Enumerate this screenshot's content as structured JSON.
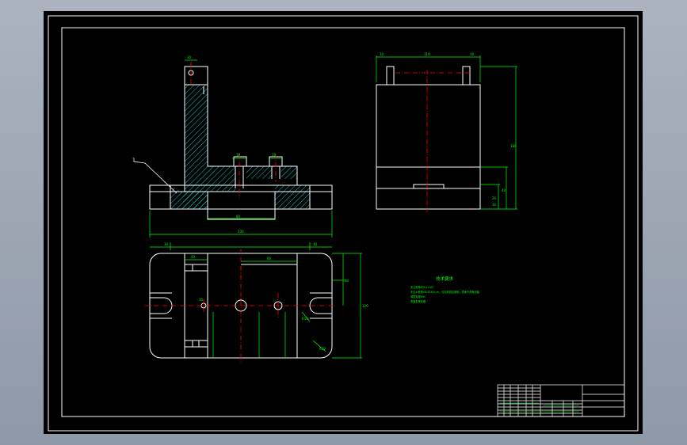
{
  "colors": {
    "background": "#000000",
    "outline": "#ffffff",
    "dimension": "#00ff00",
    "centerline": "#ff0000",
    "hatch": "#00ffff"
  },
  "part_label": "1",
  "tech_requirements": {
    "title": "技术要求",
    "lines": [
      "未注倒角均为1×45°",
      "未注公差按GB/T1804-m，去毛刺锐边倒钝，表面不得有划痕",
      "调质处理HRC",
      "表面发黑处理"
    ]
  },
  "dimensions": {
    "front_top": "30",
    "front_hole": "10",
    "front_right_hole": "10",
    "front_slot": "80",
    "front_total": "230",
    "front_left": "30",
    "front_right": "30",
    "side_left": "10",
    "side_width": "110",
    "side_right": "10",
    "side_height": "180",
    "side_h1": "40",
    "side_h2": "20",
    "side_h3": "10",
    "plan_w1": "50",
    "plan_w2": "60",
    "plan_h1": "80",
    "plan_h2": "120",
    "plan_r": "R10",
    "plan_r2": "R10",
    "plan_hole": "10"
  }
}
